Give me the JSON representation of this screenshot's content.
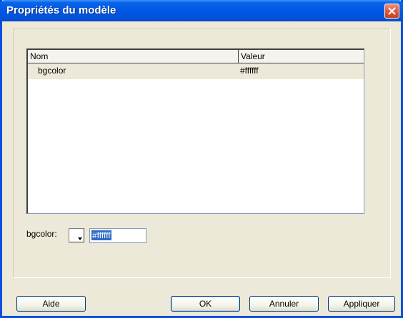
{
  "window": {
    "title": "Propriétés du modèle"
  },
  "icons": {
    "close": "close-icon",
    "dropdown": "chevron-down-icon"
  },
  "colors": {
    "titlebar": "#0058e6",
    "close_button": "#e2593c",
    "dialog_bg": "#ece9d8",
    "selection": "#316ac5"
  },
  "list": {
    "columns": [
      "Nom",
      "Valeur"
    ],
    "rows": [
      {
        "name": "bgcolor",
        "value": "#ffffff"
      }
    ]
  },
  "editor": {
    "label": "bgcolor:",
    "value": "#ffffff"
  },
  "buttons": {
    "help": "Aide",
    "ok": "OK",
    "cancel": "Annuler",
    "apply": "Appliquer"
  }
}
